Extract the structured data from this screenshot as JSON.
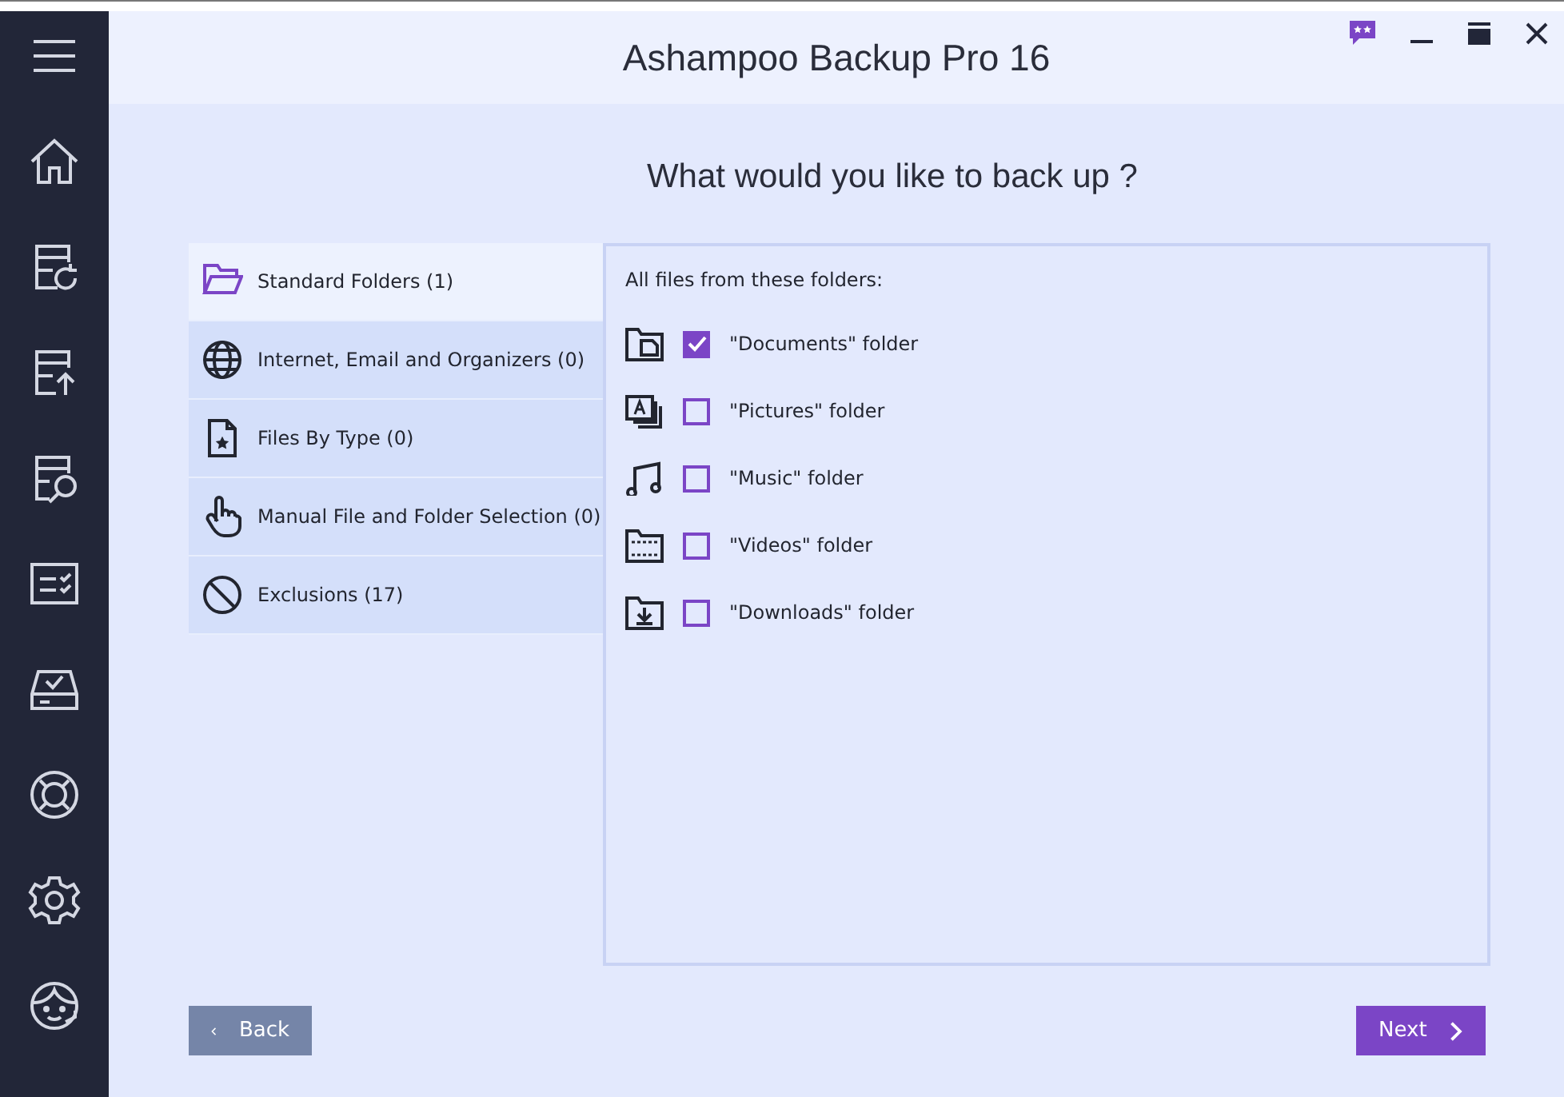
{
  "window": {
    "title": "Ashampoo Backup Pro 16"
  },
  "heading": "What would you like to back up ?",
  "categories": [
    {
      "kind": "folder",
      "label": "Standard Folders (1)",
      "selected": true
    },
    {
      "kind": "globe",
      "label": "Internet, Email and Organizers (0)",
      "selected": false
    },
    {
      "kind": "filetype",
      "label": "Files By Type (0)",
      "selected": false
    },
    {
      "kind": "hand",
      "label": "Manual File and Folder Selection (0)",
      "selected": false
    },
    {
      "kind": "exclude",
      "label": "Exclusions (17)",
      "selected": false
    }
  ],
  "panel": {
    "caption": "All files from these folders:",
    "folders": [
      {
        "kind": "documents",
        "label": "\"Documents\" folder",
        "checked": true
      },
      {
        "kind": "pictures",
        "label": "\"Pictures\" folder",
        "checked": false
      },
      {
        "kind": "music",
        "label": "\"Music\" folder",
        "checked": false
      },
      {
        "kind": "videos",
        "label": "\"Videos\" folder",
        "checked": false
      },
      {
        "kind": "downloads",
        "label": "\"Downloads\" folder",
        "checked": false
      }
    ]
  },
  "buttons": {
    "back": "Back",
    "next": "Next"
  }
}
